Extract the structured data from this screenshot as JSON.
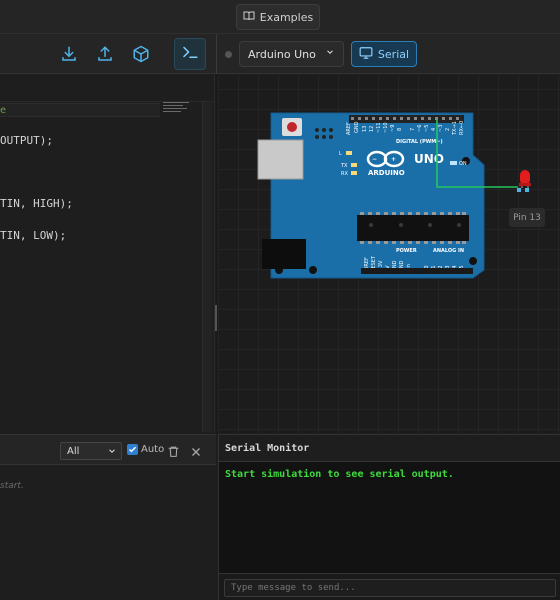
{
  "header": {
    "examples_label": "Examples"
  },
  "toolbar": {
    "icons": [
      "download-icon",
      "upload-icon",
      "box-icon",
      "terminal-icon"
    ],
    "board": "Arduino Uno",
    "serial_label": "Serial",
    "accent": "#2a7fb8"
  },
  "editor": {
    "comment_fragment": "e",
    "lines": [
      "OUTPUT);",
      "TIN, HIGH);",
      "TIN, LOW);"
    ]
  },
  "simulator": {
    "board_name": "ARDUINO",
    "board_model": "UNO",
    "digital_header": "DIGITAL (PWM~)",
    "power_header": "POWER",
    "analog_header": "ANALOG IN",
    "labels": [
      "AREF",
      "GND",
      "13",
      "12",
      "~11",
      "~10",
      "~9",
      "8",
      "7",
      "~6",
      "~5",
      "4",
      "~3",
      "2",
      "TX→1",
      "RX←0",
      "L",
      "TX",
      "RX",
      "ON",
      "IOREF",
      "RESET",
      "3.3V",
      "5V",
      "GND",
      "GND",
      "Vin",
      "A0",
      "A1",
      "A2",
      "A3",
      "A4",
      "A5"
    ],
    "pin_label": "Pin 13",
    "wire_color": "#22c55e",
    "led_color": "#e11d1d"
  },
  "console": {
    "filter": "All",
    "auto_label": "Auto",
    "hint": "start."
  },
  "serial_monitor": {
    "title": "Serial Monitor",
    "output": "Start simulation to see serial output.",
    "input_placeholder": "Type message to send...",
    "output_color": "#3ddc3d"
  }
}
